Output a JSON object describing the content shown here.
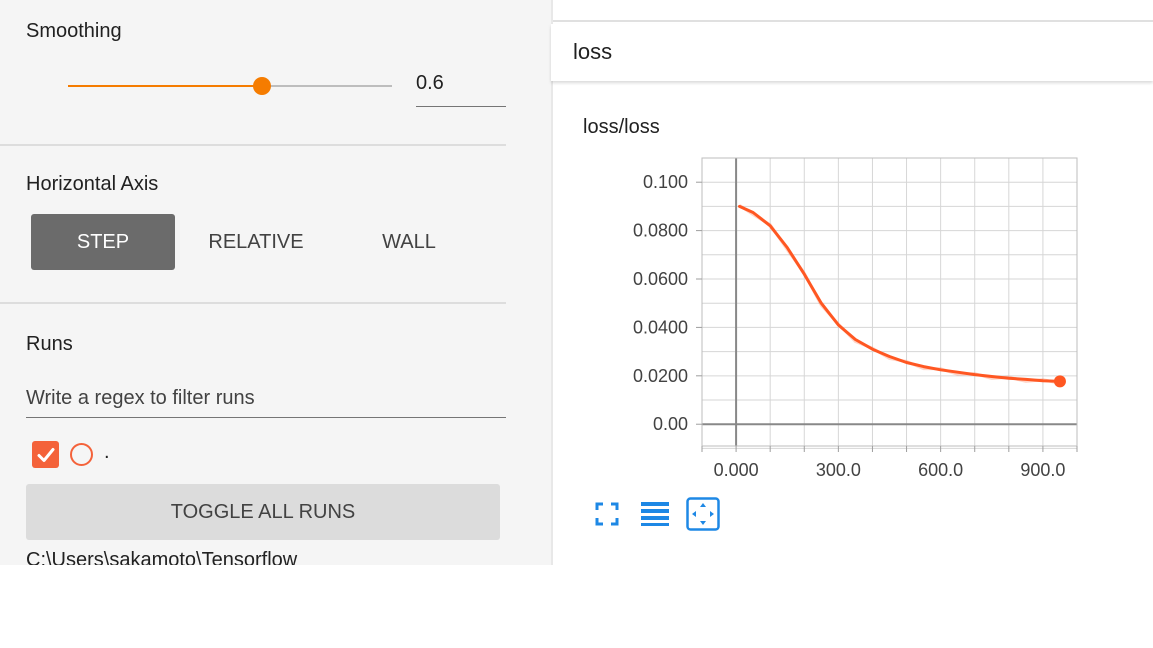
{
  "sidebar": {
    "smoothing": {
      "title": "Smoothing",
      "value": 0.6,
      "value_text": "0.6"
    },
    "horizontal_axis": {
      "title": "Horizontal Axis",
      "options": [
        "STEP",
        "RELATIVE",
        "WALL"
      ],
      "selected": "STEP"
    },
    "runs": {
      "title": "Runs",
      "filter_placeholder": "Write a regex to filter runs",
      "items": [
        {
          "name": ".",
          "checked": true,
          "color": "#f4623a"
        }
      ],
      "toggle_label": "TOGGLE ALL RUNS",
      "logdir": "C:\\Users\\sakamoto\\Tensorflow"
    }
  },
  "card": {
    "title": "loss"
  },
  "chart_data": {
    "type": "line",
    "title": "loss/loss",
    "xlim": [
      -100,
      1000
    ],
    "ylim": [
      -0.009,
      0.11
    ],
    "x_ticks": [
      "0.000",
      "300.0",
      "600.0",
      "900.0"
    ],
    "x_tick_values": [
      0,
      300,
      600,
      900
    ],
    "y_ticks": [
      "0.100",
      "0.0800",
      "0.0600",
      "0.0400",
      "0.0200",
      "0.00"
    ],
    "y_tick_values": [
      0.1,
      0.08,
      0.06,
      0.04,
      0.02,
      0
    ],
    "grid": true,
    "series": [
      {
        "color": "#ff5722",
        "x": [
          10,
          50,
          100,
          150,
          200,
          250,
          300,
          350,
          400,
          450,
          500,
          550,
          600,
          650,
          700,
          750,
          800,
          850,
          900,
          950
        ],
        "y": [
          0.09,
          0.0875,
          0.082,
          0.073,
          0.062,
          0.05,
          0.041,
          0.035,
          0.031,
          0.028,
          0.0255,
          0.0238,
          0.0225,
          0.0215,
          0.0205,
          0.0197,
          0.019,
          0.0185,
          0.018,
          0.0177
        ]
      }
    ]
  },
  "toolbar": {
    "icons": [
      "fullscreen-icon",
      "log-scale-icon",
      "fit-domain-icon"
    ]
  },
  "colors": {
    "accent": "#f57c00",
    "run": "#f4623a",
    "selected_button": "#6b6b6b",
    "icon_blue": "#1e88e5"
  }
}
